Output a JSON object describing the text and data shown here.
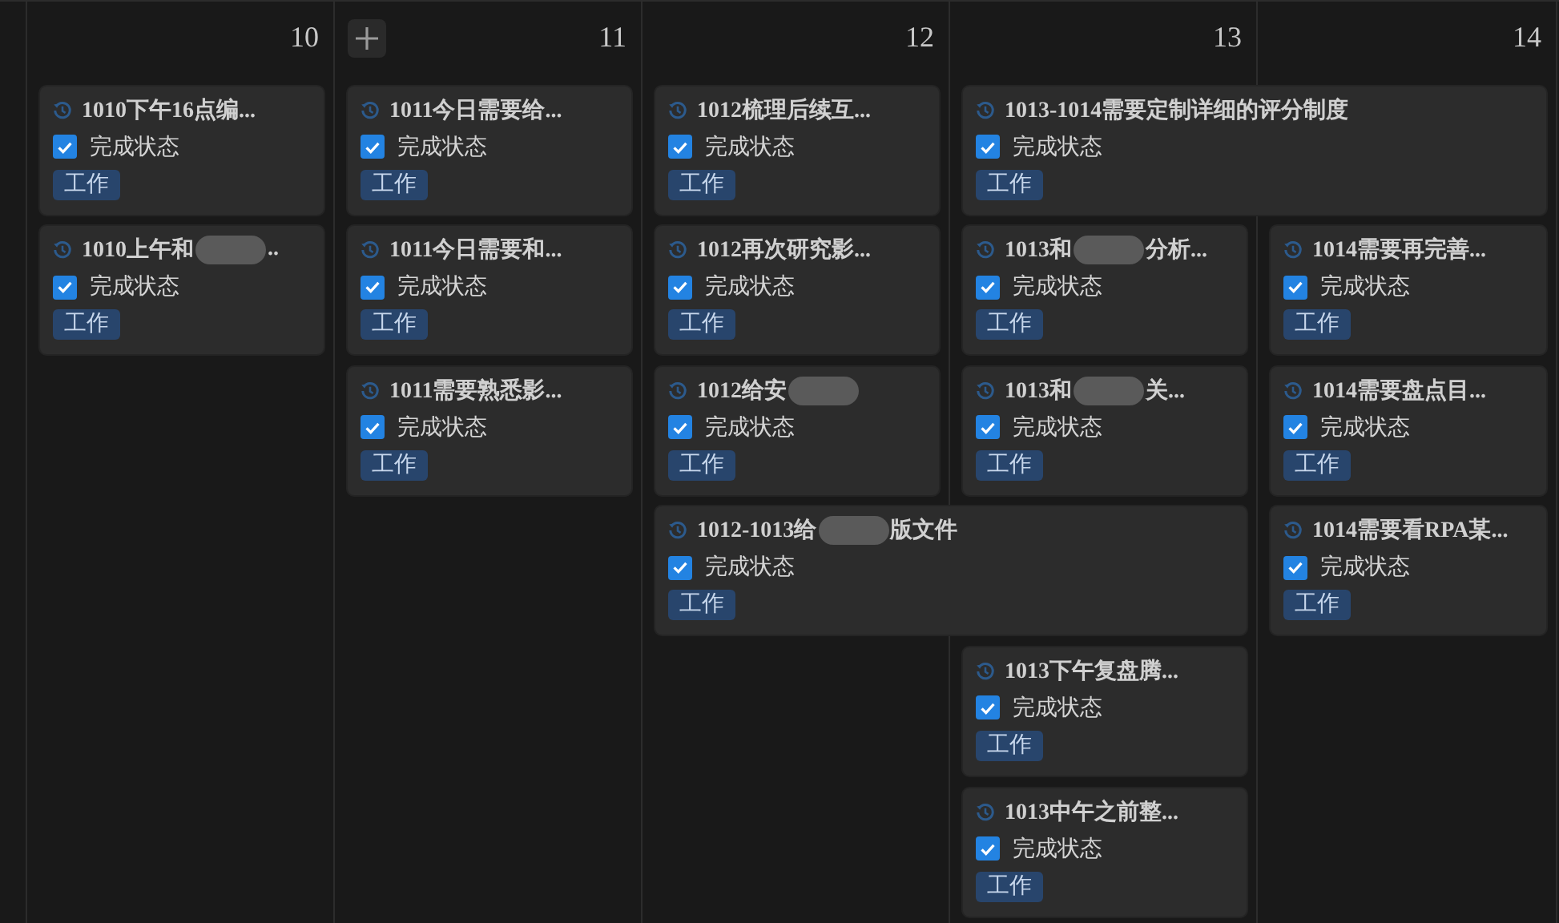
{
  "columns": [
    {
      "day": "10",
      "add_button": false,
      "events": [
        {
          "title": "1010下午16点编...",
          "redacted": false,
          "spans_next_day": false,
          "done": true,
          "done_label": "完成状态",
          "tag": {
            "label": "工作",
            "color": "#28456c"
          }
        },
        {
          "title": "1010上午和",
          "redacted": true,
          "title_after": "..",
          "spans_next_day": false,
          "done": true,
          "done_label": "完成状态",
          "tag": {
            "label": "工作",
            "color": "#28456c"
          }
        }
      ]
    },
    {
      "day": "11",
      "add_button": true,
      "events": [
        {
          "title": "1011今日需要给...",
          "redacted": false,
          "spans_next_day": false,
          "done": true,
          "done_label": "完成状态",
          "tag": {
            "label": "工作",
            "color": "#28456c"
          }
        },
        {
          "title": "1011今日需要和...",
          "redacted": false,
          "spans_next_day": false,
          "done": true,
          "done_label": "完成状态",
          "tag": {
            "label": "工作",
            "color": "#28456c"
          }
        },
        {
          "title": "1011需要熟悉影...",
          "redacted": false,
          "spans_next_day": false,
          "done": true,
          "done_label": "完成状态",
          "tag": {
            "label": "工作",
            "color": "#28456c"
          }
        }
      ]
    },
    {
      "day": "12",
      "add_button": false,
      "events": [
        {
          "title": "1012梳理后续互...",
          "redacted": false,
          "spans_next_day": false,
          "done": true,
          "done_label": "完成状态",
          "tag": {
            "label": "工作",
            "color": "#28456c"
          }
        },
        {
          "title": "1012再次研究影...",
          "redacted": false,
          "spans_next_day": false,
          "done": true,
          "done_label": "完成状态",
          "tag": {
            "label": "工作",
            "color": "#28456c"
          }
        },
        {
          "title": "1012给安",
          "redacted": true,
          "spans_next_day": false,
          "done": true,
          "done_label": "完成状态",
          "tag": {
            "label": "工作",
            "color": "#28456c"
          }
        },
        {
          "title": "1012-1013给",
          "redacted": true,
          "title_after": "版文件",
          "spans_next_day": true,
          "done": true,
          "done_label": "完成状态",
          "tag": {
            "label": "工作",
            "color": "#28456c"
          }
        }
      ]
    },
    {
      "day": "13",
      "add_button": false,
      "events": [
        {
          "title": "1013-1014需要定制详细的评分制度",
          "redacted": false,
          "spans_next_day": true,
          "done": true,
          "done_label": "完成状态",
          "tag": {
            "label": "工作",
            "color": "#28456c"
          }
        },
        {
          "title": "1013和",
          "redacted": true,
          "title_after": "分析...",
          "spans_next_day": false,
          "done": true,
          "done_label": "完成状态",
          "tag": {
            "label": "工作",
            "color": "#28456c"
          }
        },
        {
          "title": "1013和",
          "redacted": true,
          "title_after": "关...",
          "spans_next_day": false,
          "done": true,
          "done_label": "完成状态",
          "tag": {
            "label": "工作",
            "color": "#28456c"
          }
        },
        {
          "title": "1013下午复盘腾...",
          "redacted": false,
          "spans_next_day": false,
          "done": true,
          "done_label": "完成状态",
          "tag": {
            "label": "工作",
            "color": "#28456c"
          }
        },
        {
          "title": "1013中午之前整...",
          "redacted": false,
          "spans_next_day": false,
          "done": true,
          "done_label": "完成状态",
          "tag": {
            "label": "工作",
            "color": "#28456c"
          }
        }
      ]
    },
    {
      "day": "14",
      "add_button": false,
      "events": [
        {
          "title": "1014需要再完善...",
          "redacted": false,
          "spans_next_day": false,
          "done": true,
          "done_label": "完成状态",
          "tag": {
            "label": "工作",
            "color": "#28456c"
          }
        },
        {
          "title": "1014需要盘点目...",
          "redacted": false,
          "spans_next_day": false,
          "done": true,
          "done_label": "完成状态",
          "tag": {
            "label": "工作",
            "color": "#28456c"
          }
        },
        {
          "title": "1014需要看RPA某...",
          "redacted": false,
          "spans_next_day": false,
          "done": true,
          "done_label": "完成状态",
          "tag": {
            "label": "工作",
            "color": "#28456c"
          }
        }
      ]
    }
  ]
}
